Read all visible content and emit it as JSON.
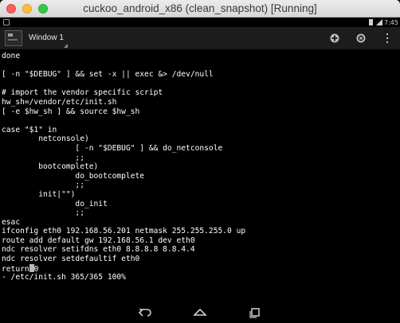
{
  "window": {
    "title": "cuckoo_android_x86 (clean_snapshot) [Running]"
  },
  "statusbar": {
    "clock": "7:45",
    "colors": {
      "icons": "#cfcfcf"
    }
  },
  "actionbar": {
    "tab_label": "Window 1",
    "icons": [
      "new-window-icon",
      "close-window-icon",
      "overflow-menu-icon"
    ]
  },
  "terminal": {
    "lines": [
      "done",
      "",
      "[ -n \"$DEBUG\" ] && set -x || exec &> /dev/null",
      "",
      "# import the vendor specific script",
      "hw_sh=/vendor/etc/init.sh",
      "[ -e $hw_sh ] && source $hw_sh",
      "",
      "case \"$1\" in",
      "        netconsole)",
      "                [ -n \"$DEBUG\" ] && do_netconsole",
      "                ;;",
      "        bootcomplete)",
      "                do_bootcomplete",
      "                ;;",
      "        init|\"\")",
      "                do_init",
      "                ;;",
      "esac",
      "ifconfig eth0 192.168.56.201 netmask 255.255.255.0 up",
      "route add default gw 192.168.56.1 dev eth0",
      "ndc resolver setifdns eth0 8.8.8.8 8.8.4.4",
      "ndc resolver setdefaultif eth0",
      "return",
      "- /etc/init.sh 365/365 100%"
    ],
    "cursor_line_prefix": "return",
    "cursor_line_suffix": "0",
    "colors": {
      "foreground": "#ffffff",
      "background": "#000000"
    }
  },
  "navbar": {
    "buttons": [
      "back-icon",
      "home-icon",
      "recent-apps-icon"
    ]
  }
}
